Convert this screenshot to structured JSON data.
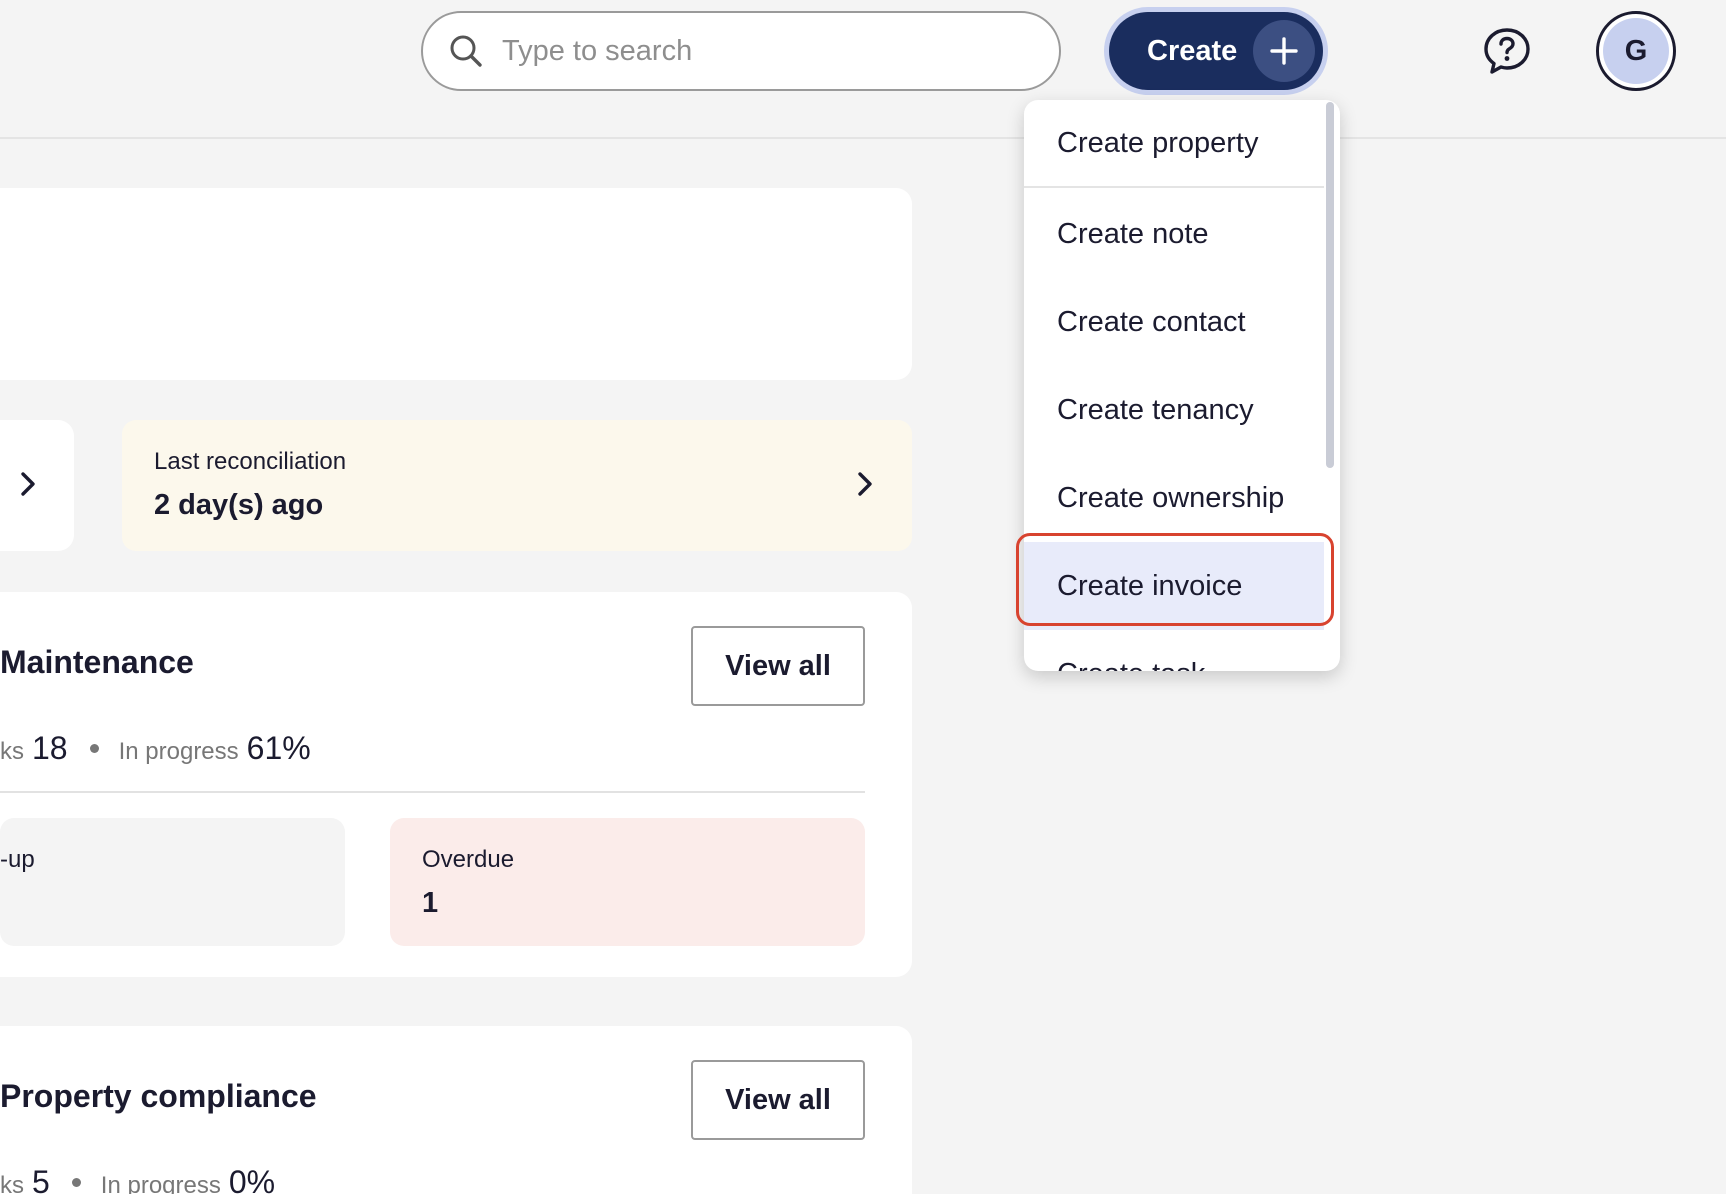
{
  "header": {
    "search_placeholder": "Type to search",
    "create_label": "Create",
    "avatar_initial": "G"
  },
  "reconciliation": {
    "label": "Last reconciliation",
    "value": "2 day(s) ago"
  },
  "maintenance": {
    "title": "Maintenance",
    "view_all": "View all",
    "tasks_label_partial": "ks",
    "tasks_count": "18",
    "in_progress_label": "In progress",
    "in_progress_value": "61%",
    "followup_label_partial": "-up",
    "overdue_label": "Overdue",
    "overdue_value": "1"
  },
  "compliance": {
    "title": "Property compliance",
    "view_all": "View all",
    "tasks_label_partial": "ks",
    "tasks_count": "5",
    "in_progress_label": "In progress",
    "in_progress_value": "0%"
  },
  "create_menu": {
    "items": [
      {
        "label": "Create property"
      },
      {
        "label": "Create note"
      },
      {
        "label": "Create contact"
      },
      {
        "label": "Create tenancy"
      },
      {
        "label": "Create ownership"
      },
      {
        "label": "Create invoice",
        "highlighted": true
      },
      {
        "label": "Create task"
      }
    ]
  },
  "colors": {
    "primary": "#1a2d5e",
    "highlight_outline": "#d8432f",
    "highlight_bg": "#e8ebfa",
    "reconciliation_bg": "#fcf8ec",
    "overdue_bg": "#fbecea"
  }
}
